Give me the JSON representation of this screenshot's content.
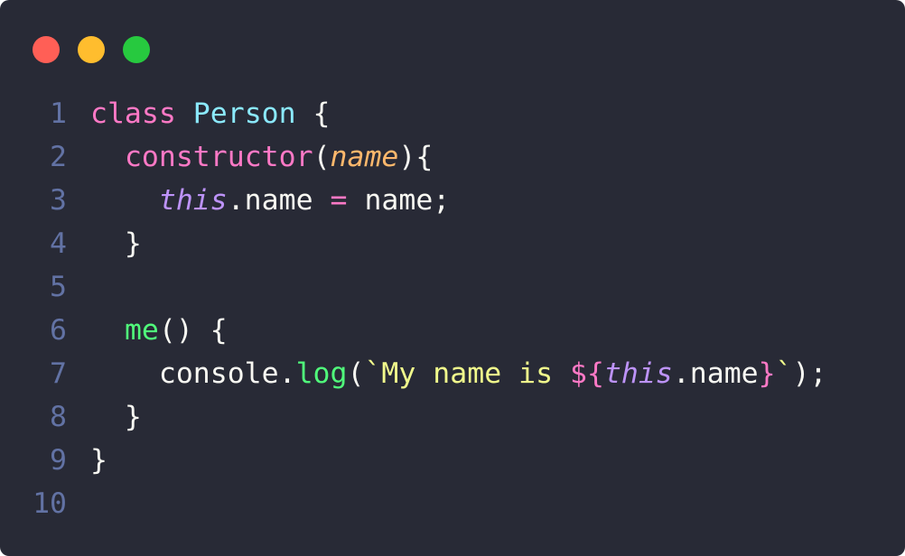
{
  "window": {
    "controls": [
      "close",
      "minimize",
      "maximize"
    ]
  },
  "colors": {
    "background": "#282a36",
    "line_number": "#6272a4",
    "keyword": "#ff79c6",
    "class_name": "#8be9fd",
    "function": "#50fa7b",
    "parameter": "#ffb86c",
    "this": "#bd93f9",
    "string": "#f1fa8c",
    "default": "#f8f8f2"
  },
  "lines": [
    {
      "number": "1",
      "tokens": [
        {
          "text": "class",
          "type": "kw"
        },
        {
          "text": " ",
          "type": "plain"
        },
        {
          "text": "Person",
          "type": "cls"
        },
        {
          "text": " {",
          "type": "plain"
        }
      ]
    },
    {
      "number": "2",
      "tokens": [
        {
          "text": "  ",
          "type": "plain"
        },
        {
          "text": "constructor",
          "type": "kw"
        },
        {
          "text": "(",
          "type": "plain"
        },
        {
          "text": "name",
          "type": "param"
        },
        {
          "text": "){",
          "type": "plain"
        }
      ]
    },
    {
      "number": "3",
      "tokens": [
        {
          "text": "    ",
          "type": "plain"
        },
        {
          "text": "this",
          "type": "this"
        },
        {
          "text": ".name ",
          "type": "plain"
        },
        {
          "text": "=",
          "type": "kw"
        },
        {
          "text": " name;",
          "type": "plain"
        }
      ]
    },
    {
      "number": "4",
      "tokens": [
        {
          "text": "  }",
          "type": "plain"
        }
      ]
    },
    {
      "number": "5",
      "tokens": []
    },
    {
      "number": "6",
      "tokens": [
        {
          "text": "  ",
          "type": "plain"
        },
        {
          "text": "me",
          "type": "fn"
        },
        {
          "text": "() {",
          "type": "plain"
        }
      ]
    },
    {
      "number": "7",
      "tokens": [
        {
          "text": "    console.",
          "type": "plain"
        },
        {
          "text": "log",
          "type": "fn"
        },
        {
          "text": "(",
          "type": "plain"
        },
        {
          "text": "`My name is ",
          "type": "str"
        },
        {
          "text": "${",
          "type": "interp"
        },
        {
          "text": "this",
          "type": "this"
        },
        {
          "text": ".name",
          "type": "plain"
        },
        {
          "text": "}",
          "type": "interp"
        },
        {
          "text": "`",
          "type": "str"
        },
        {
          "text": ");",
          "type": "plain"
        }
      ]
    },
    {
      "number": "8",
      "tokens": [
        {
          "text": "  }",
          "type": "plain"
        }
      ]
    },
    {
      "number": "9",
      "tokens": [
        {
          "text": "}",
          "type": "plain"
        }
      ]
    },
    {
      "number": "10",
      "tokens": []
    }
  ]
}
